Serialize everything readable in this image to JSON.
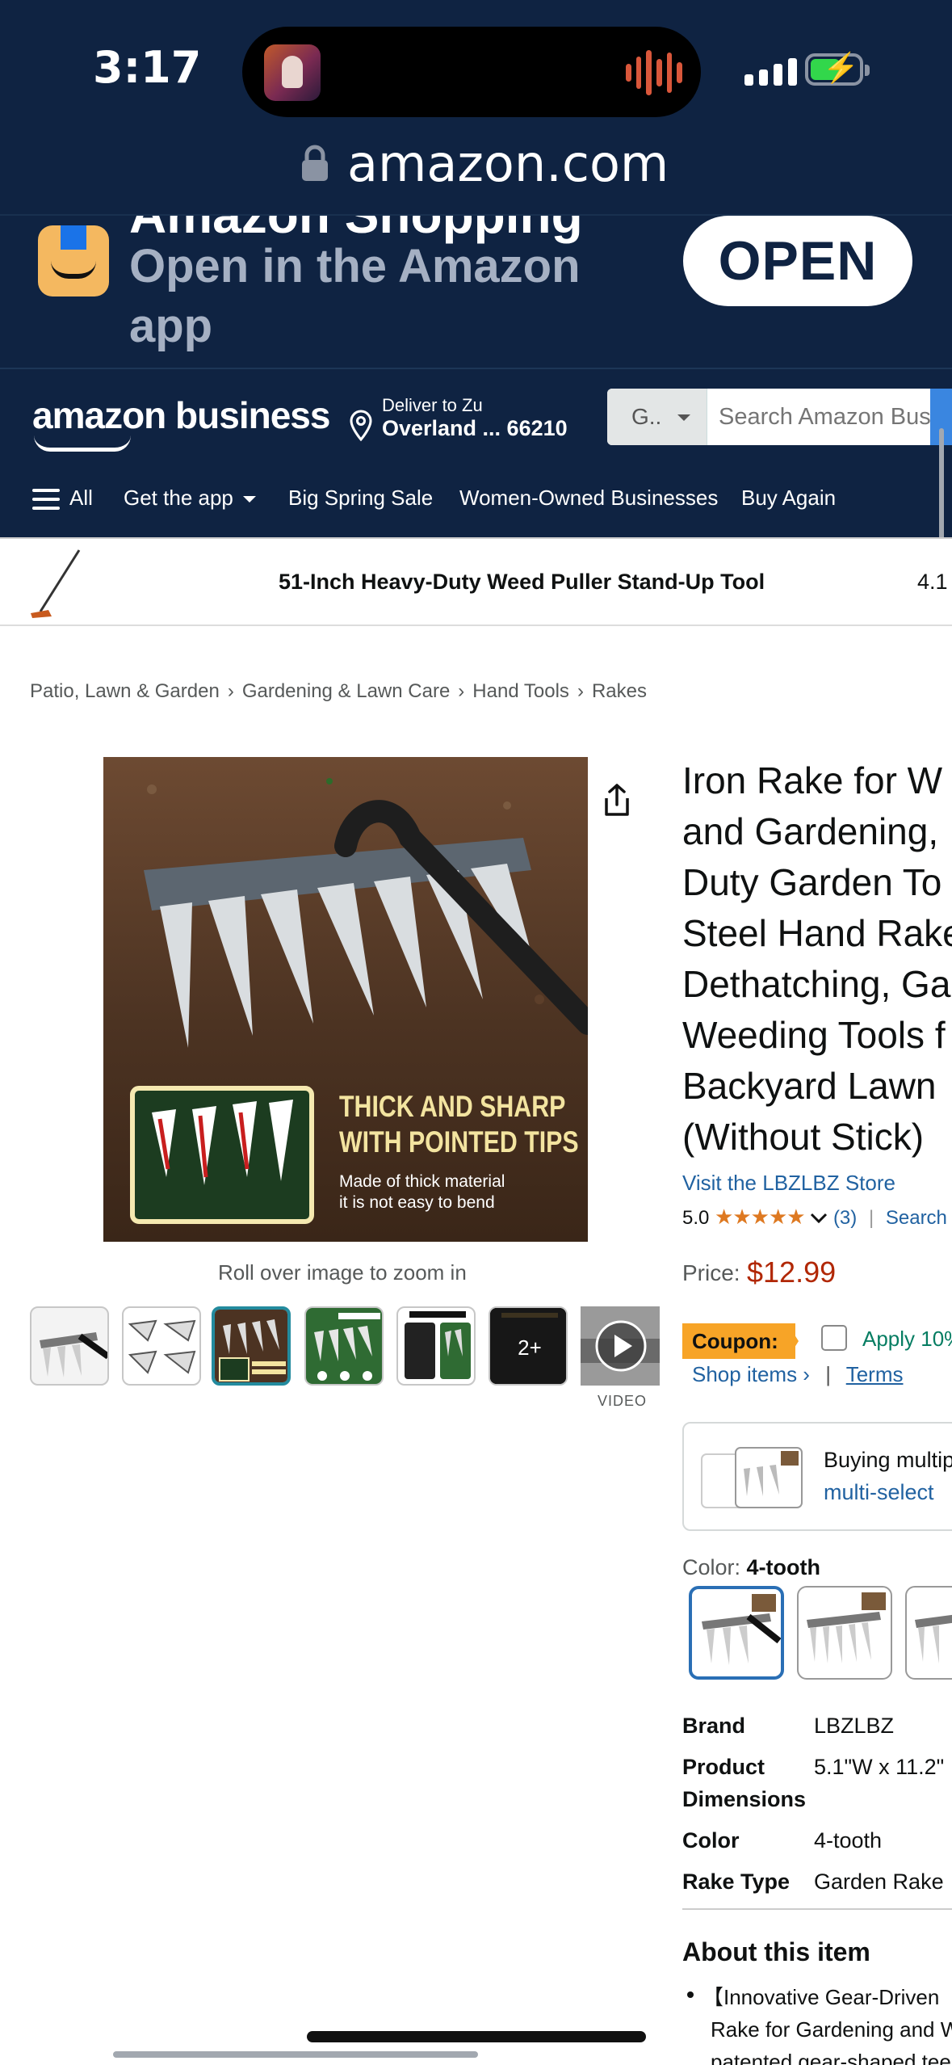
{
  "status": {
    "time": "3:17"
  },
  "browser": {
    "url": "amazon.com"
  },
  "app_banner": {
    "clipped_title": "Amazon Shopping",
    "text": "Open in the Amazon app",
    "open_label": "OPEN"
  },
  "header": {
    "logo": "amazon business",
    "deliver_line1": "Deliver to Zu",
    "deliver_line2": "Overland ... 66210",
    "search_category": "G..",
    "search_placeholder": "Search Amazon Business"
  },
  "nav": {
    "items": [
      "All",
      "Get the app",
      "Big Spring Sale",
      "Women-Owned Businesses",
      "Buy Again"
    ]
  },
  "sticky": {
    "title": "51-Inch Heavy-Duty Weed Puller Stand-Up Tool",
    "rating": "4.1"
  },
  "breadcrumbs": [
    "Patio, Lawn & Garden",
    "Gardening & Lawn Care",
    "Hand Tools",
    "Rakes"
  ],
  "gallery": {
    "overlay_line1": "THICK AND SHARP",
    "overlay_line2": "WITH POINTED TIPS",
    "overlay_line3": "Made of thick material",
    "overlay_line4": "it is not easy to bend",
    "zoom_hint": "Roll over image to zoom in",
    "more_count": "2+",
    "video_label": "VIDEO"
  },
  "product": {
    "title_lines": [
      "Iron Rake for W",
      "and Gardening,",
      "Duty Garden To",
      "Steel Hand Rake",
      "Dethatching, Ga",
      "Weeding Tools f",
      "Backyard Lawn",
      "(Without Stick)"
    ],
    "store": "Visit the LBZLBZ Store",
    "rating_value": "5.0",
    "stars": "★★★★★",
    "rating_count": "(3)",
    "search_link": "Search",
    "price_label": "Price:",
    "price": "$12.99",
    "coupon_label": "Coupon:",
    "apply_text": "Apply 10%",
    "shop_items": "Shop items ›",
    "terms": "Terms",
    "bulk_line1": "Buying multiple",
    "bulk_line2": "multi-select",
    "color_label": "Color:",
    "color_value": "4-tooth",
    "specs": [
      {
        "k": "Brand",
        "v": "LBZLBZ"
      },
      {
        "k": "Product Dimensions",
        "v": "5.1\"W x 11.2\""
      },
      {
        "k": "Color",
        "v": "4-tooth"
      },
      {
        "k": "Rake Type",
        "v": "Garden Rake"
      }
    ],
    "about_title": "About this item",
    "about_lines": [
      "【Innovative Gear-Driven",
      "Rake for Gardening and W",
      "patented gear-shaped tee"
    ]
  },
  "colors": {
    "navy": "#0f2342",
    "link": "#2162a1",
    "price": "#b12704",
    "coupon": "#f7a427",
    "star": "#de7921"
  }
}
